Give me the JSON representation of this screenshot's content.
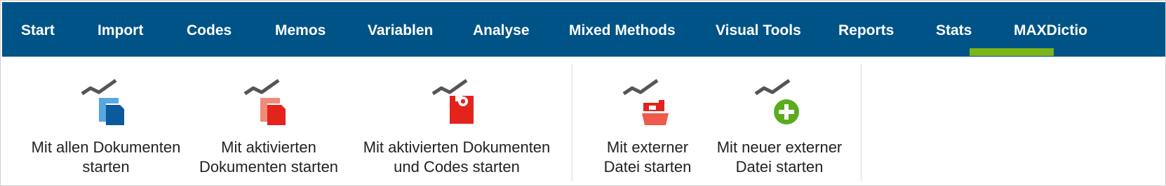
{
  "menu": {
    "tabs": [
      {
        "label": "Start"
      },
      {
        "label": "Import"
      },
      {
        "label": "Codes"
      },
      {
        "label": "Memos"
      },
      {
        "label": "Variablen"
      },
      {
        "label": "Analyse"
      },
      {
        "label": "Mixed Methods"
      },
      {
        "label": "Visual Tools"
      },
      {
        "label": "Reports"
      },
      {
        "label": "Stats"
      },
      {
        "label": "MAXDictio"
      }
    ],
    "active_tab": "Stats",
    "active_color": "#7cb518"
  },
  "colors": {
    "menubar_bg": "#005386",
    "icon_red": "#e3231c",
    "icon_blue": "#0a5a9c",
    "icon_green": "#5aac1e",
    "icon_gray": "#555555"
  },
  "ribbon": {
    "buttons": [
      {
        "line1": "Mit allen Dokumenten",
        "line2": "starten",
        "icon": "chart-with-documents-icon"
      },
      {
        "line1": "Mit aktivierten",
        "line2": "Dokumenten starten",
        "icon": "chart-with-activated-documents-icon"
      },
      {
        "line1": "Mit aktivierten Dokumenten",
        "line2": "und Codes starten",
        "icon": "chart-with-documents-and-codes-icon"
      },
      {
        "line1": "Mit externer",
        "line2": "Datei starten",
        "icon": "chart-with-folder-icon"
      },
      {
        "line1": "Mit neuer externer",
        "line2": "Datei starten",
        "icon": "chart-with-add-icon"
      }
    ]
  }
}
